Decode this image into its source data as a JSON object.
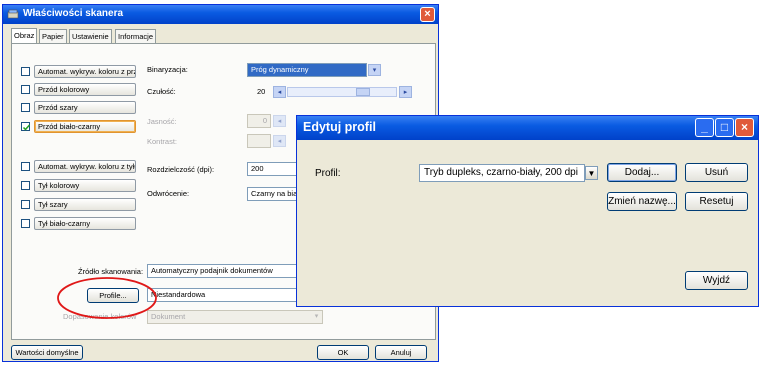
{
  "scanner_window": {
    "title": "Właściwości skanera",
    "tabs": [
      {
        "label": "Obraz",
        "active": true
      },
      {
        "label": "Papier"
      },
      {
        "label": "Ustawienie"
      },
      {
        "label": "Informacje"
      }
    ],
    "image_items": [
      {
        "label": "Automat. wykryw. koloru z prz",
        "checked": false
      },
      {
        "label": "Przód kolorowy",
        "checked": false
      },
      {
        "label": "Przód szary",
        "checked": false
      },
      {
        "label": "Przód biało-czarny",
        "checked": true
      }
    ],
    "back_items": [
      {
        "label": "Automat. wykryw. koloru z tyłu",
        "checked": false
      },
      {
        "label": "Tył kolorowy",
        "checked": false
      },
      {
        "label": "Tył szary",
        "checked": false
      },
      {
        "label": "Tył biało-czarny",
        "checked": false
      }
    ],
    "binarization_label": "Binaryzacja:",
    "binarization_value": "Próg dynamiczny",
    "sensitivity_label": "Czułość:",
    "sensitivity_value": "20",
    "brightness_label": "Jasność:",
    "brightness_value": "0",
    "contrast_label": "Kontrast:",
    "resolution_label": "Rozdzielczość (dpi):",
    "resolution_value": "200",
    "inversion_label": "Odwrócenie:",
    "inversion_value": "Czarny na biał",
    "source_label": "Źródło skanowania:",
    "source_value": "Automatyczny podajnik dokumentów",
    "profile_button": "Profile...",
    "profile_value": "Niestandardowa",
    "color_match_label": "Dopasowanie kolorów",
    "color_match_value": "Dokument",
    "defaults_button": "Wartości domyślne",
    "ok_button": "OK",
    "cancel_button": "Anuluj"
  },
  "profile_dialog": {
    "title": "Edytuj profil",
    "profile_label": "Profil:",
    "profile_value": "Tryb dupleks, czarno-biały, 200 dpi",
    "add_button": "Dodaj...",
    "delete_button": "Usuń",
    "rename_button": "Zmień nazwę...",
    "reset_button": "Resetuj",
    "exit_button": "Wyjdź"
  },
  "colors": {
    "titlebar": "#0a5be2",
    "dialog_bg": "#ece9d8",
    "close_button": "#e05a3a",
    "annotation_circle": "#e01818"
  }
}
